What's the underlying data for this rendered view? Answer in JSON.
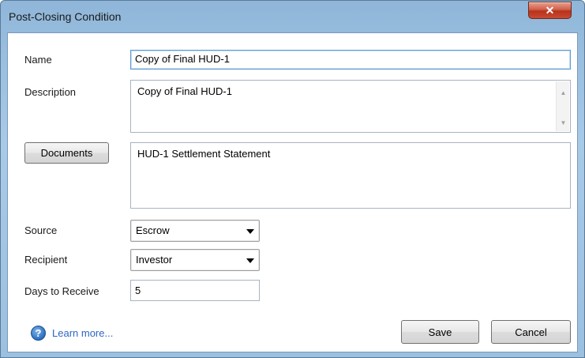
{
  "window": {
    "title": "Post-Closing Condition",
    "close_glyph": "✕"
  },
  "form": {
    "name_label": "Name",
    "name_value": "Copy of Final HUD-1",
    "description_label": "Description",
    "description_value": "Copy of Final HUD-1",
    "documents_button": "Documents",
    "documents_value": "HUD-1 Settlement Statement",
    "source_label": "Source",
    "source_value": "Escrow",
    "recipient_label": "Recipient",
    "recipient_value": "Investor",
    "days_label": "Days to Receive",
    "days_value": "5"
  },
  "footer": {
    "help_glyph": "?",
    "learn_more": "Learn more...",
    "save_label": "Save",
    "cancel_label": "Cancel"
  },
  "icons": {
    "scroll_up": "▲",
    "scroll_down": "▼"
  },
  "colors": {
    "titlebar": "#9cc0e0",
    "close_button": "#c84a32",
    "link": "#2b67c5",
    "focus_border": "#5b9bd5"
  }
}
